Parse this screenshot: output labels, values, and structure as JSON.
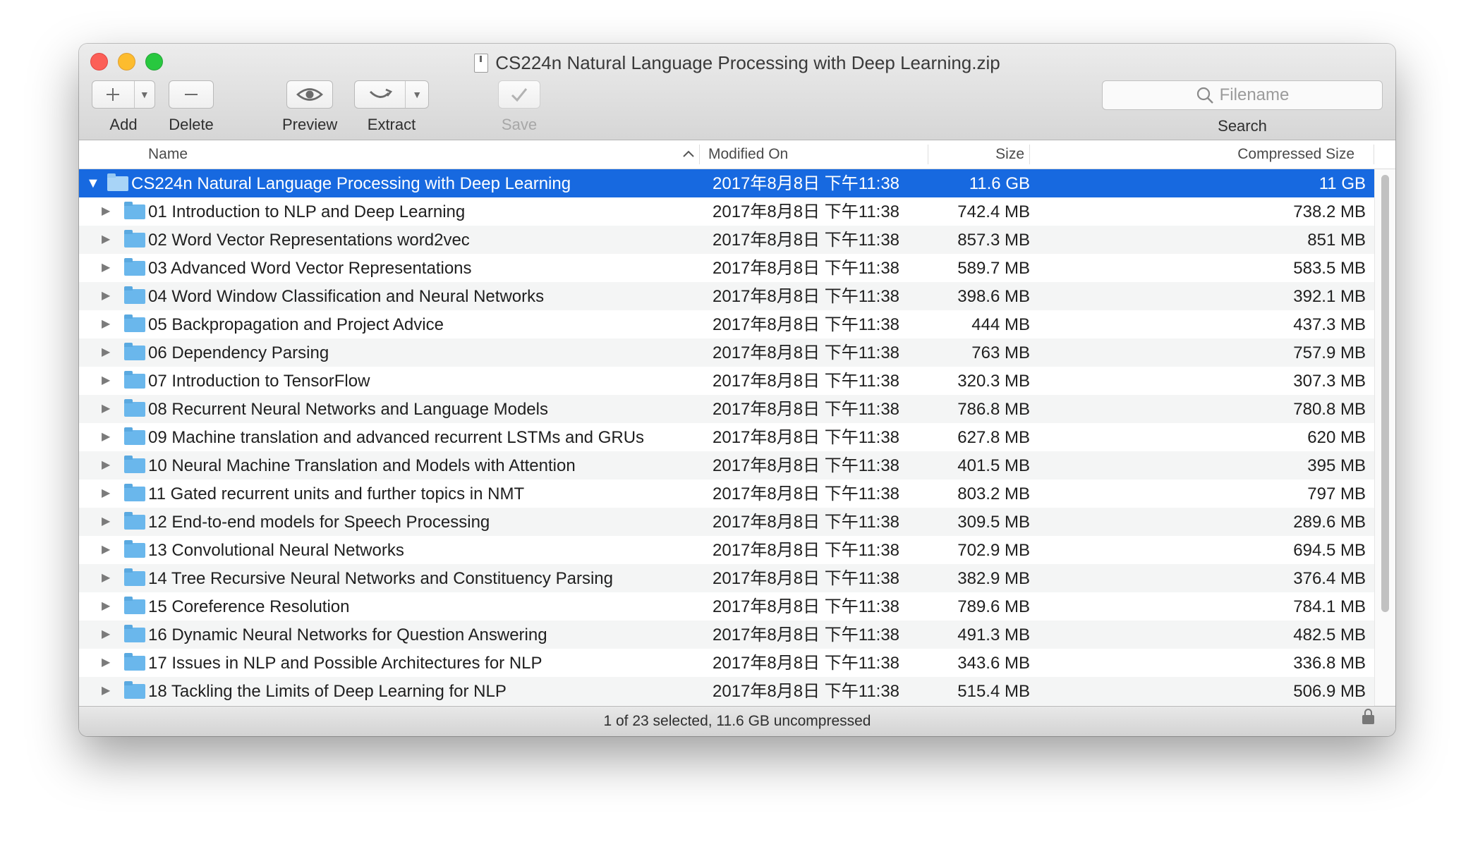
{
  "window": {
    "title": "CS224n Natural Language Processing with Deep Learning.zip"
  },
  "toolbar": {
    "add_label": "Add",
    "delete_label": "Delete",
    "preview_label": "Preview",
    "extract_label": "Extract",
    "save_label": "Save",
    "search_placeholder": "Filename",
    "search_label": "Search",
    "icons": {
      "add": "plus-icon",
      "delete": "minus-icon",
      "preview": "eye-icon",
      "extract": "extract-icon",
      "save": "checkmark-icon",
      "search": "magnifier-icon"
    }
  },
  "columns": {
    "name": "Name",
    "modified": "Modified On",
    "size": "Size",
    "compressed": "Compressed Size"
  },
  "rows": [
    {
      "name": "CS224n Natural Language Processing with Deep Learning",
      "modified": "2017年8月8日 下午11:38",
      "size": "11.6 GB",
      "compressed": "11 GB"
    },
    {
      "name": "01 Introduction to NLP and Deep Learning",
      "modified": "2017年8月8日 下午11:38",
      "size": "742.4 MB",
      "compressed": "738.2 MB"
    },
    {
      "name": "02 Word Vector Representations word2vec",
      "modified": "2017年8月8日 下午11:38",
      "size": "857.3 MB",
      "compressed": "851 MB"
    },
    {
      "name": "03 Advanced Word Vector Representations",
      "modified": "2017年8月8日 下午11:38",
      "size": "589.7 MB",
      "compressed": "583.5 MB"
    },
    {
      "name": "04 Word Window Classification and Neural Networks",
      "modified": "2017年8月8日 下午11:38",
      "size": "398.6 MB",
      "compressed": "392.1 MB"
    },
    {
      "name": "05 Backpropagation and Project Advice",
      "modified": "2017年8月8日 下午11:38",
      "size": "444 MB",
      "compressed": "437.3 MB"
    },
    {
      "name": "06 Dependency Parsing",
      "modified": "2017年8月8日 下午11:38",
      "size": "763 MB",
      "compressed": "757.9 MB"
    },
    {
      "name": "07 Introduction to TensorFlow",
      "modified": "2017年8月8日 下午11:38",
      "size": "320.3 MB",
      "compressed": "307.3 MB"
    },
    {
      "name": "08 Recurrent Neural Networks and Language Models",
      "modified": "2017年8月8日 下午11:38",
      "size": "786.8 MB",
      "compressed": "780.8 MB"
    },
    {
      "name": "09 Machine translation and advanced recurrent LSTMs and GRUs",
      "modified": "2017年8月8日 下午11:38",
      "size": "627.8 MB",
      "compressed": "620 MB"
    },
    {
      "name": "10 Neural Machine Translation and Models with Attention",
      "modified": "2017年8月8日 下午11:38",
      "size": "401.5 MB",
      "compressed": "395 MB"
    },
    {
      "name": "11 Gated recurrent units and further topics in NMT",
      "modified": "2017年8月8日 下午11:38",
      "size": "803.2 MB",
      "compressed": "797 MB"
    },
    {
      "name": "12 End-to-end models for Speech Processing",
      "modified": "2017年8月8日 下午11:38",
      "size": "309.5 MB",
      "compressed": "289.6 MB"
    },
    {
      "name": "13 Convolutional Neural Networks",
      "modified": "2017年8月8日 下午11:38",
      "size": "702.9 MB",
      "compressed": "694.5 MB"
    },
    {
      "name": "14 Tree Recursive Neural Networks and Constituency Parsing",
      "modified": "2017年8月8日 下午11:38",
      "size": "382.9 MB",
      "compressed": "376.4 MB"
    },
    {
      "name": "15 Coreference Resolution",
      "modified": "2017年8月8日 下午11:38",
      "size": "789.6 MB",
      "compressed": "784.1 MB"
    },
    {
      "name": "16 Dynamic Neural Networks for Question Answering",
      "modified": "2017年8月8日 下午11:38",
      "size": "491.3 MB",
      "compressed": "482.5 MB"
    },
    {
      "name": "17 Issues in NLP and Possible Architectures for NLP",
      "modified": "2017年8月8日 下午11:38",
      "size": "343.6 MB",
      "compressed": "336.8 MB"
    },
    {
      "name": "18 Tackling the Limits of Deep Learning for NLP",
      "modified": "2017年8月8日 下午11:38",
      "size": "515.4 MB",
      "compressed": "506.9 MB"
    }
  ],
  "status": {
    "text": "1 of 23 selected, 11.6 GB uncompressed"
  },
  "colors": {
    "selection": "#1769e0",
    "folder": "#6ab7ec"
  }
}
